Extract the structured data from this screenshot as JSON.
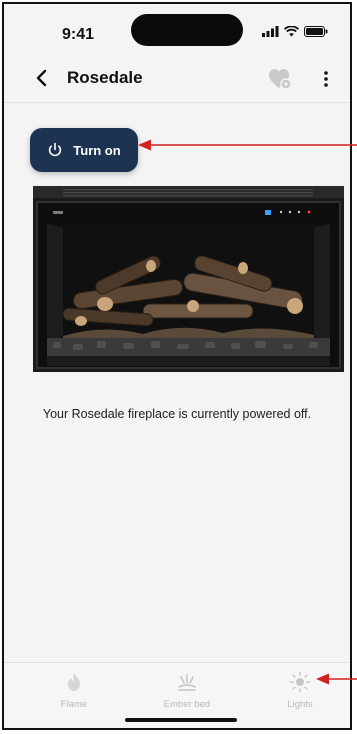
{
  "status_bar": {
    "time": "9:41"
  },
  "header": {
    "title": "Rosedale"
  },
  "power_button": {
    "label": "Turn on"
  },
  "status_message": "Your Rosedale fireplace is currently powered off.",
  "tabs": [
    {
      "label": "Flame",
      "icon": "flame-icon"
    },
    {
      "label": "Ember bed",
      "icon": "ember-bed-icon"
    },
    {
      "label": "Lights",
      "icon": "sun-icon"
    }
  ],
  "colors": {
    "button_bg": "#1d3352",
    "annotation_arrow": "#d42020",
    "inactive_tab": "#b9b9b9"
  }
}
